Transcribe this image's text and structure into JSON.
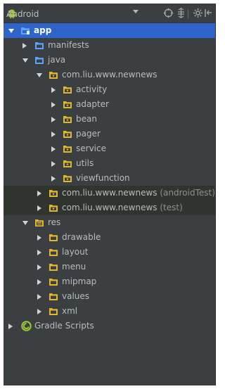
{
  "toolbar": {
    "view_label": "Android",
    "icons": [
      "android-icon",
      "target-icon",
      "collapse-icon",
      "gear-icon",
      "hide-icon"
    ]
  },
  "tree": {
    "app": "app",
    "manifests": "manifests",
    "java": "java",
    "package_main": "com.liu.www.newnews",
    "activity": "activity",
    "adapter": "adapter",
    "bean": "bean",
    "pager": "pager",
    "service": "service",
    "utils": "utils",
    "viewfunction": "viewfunction",
    "package_test_android": "com.liu.www.newnews",
    "package_test_android_suffix": "(androidTest)",
    "package_test": "com.liu.www.newnews",
    "package_test_suffix": "(test)",
    "res": "res",
    "drawable": "drawable",
    "layout": "layout",
    "menu": "menu",
    "mipmap": "mipmap",
    "values": "values",
    "xml": "xml",
    "gradle_scripts": "Gradle Scripts"
  },
  "colors": {
    "panel": "#3c3f41",
    "selected": "#2f65ca",
    "text": "#bbbbbb",
    "folder_blue": "#5ca4ff",
    "folder_yellow": "#e4b62d",
    "android_green": "#a4c639",
    "gradle_green": "#9acd32"
  }
}
